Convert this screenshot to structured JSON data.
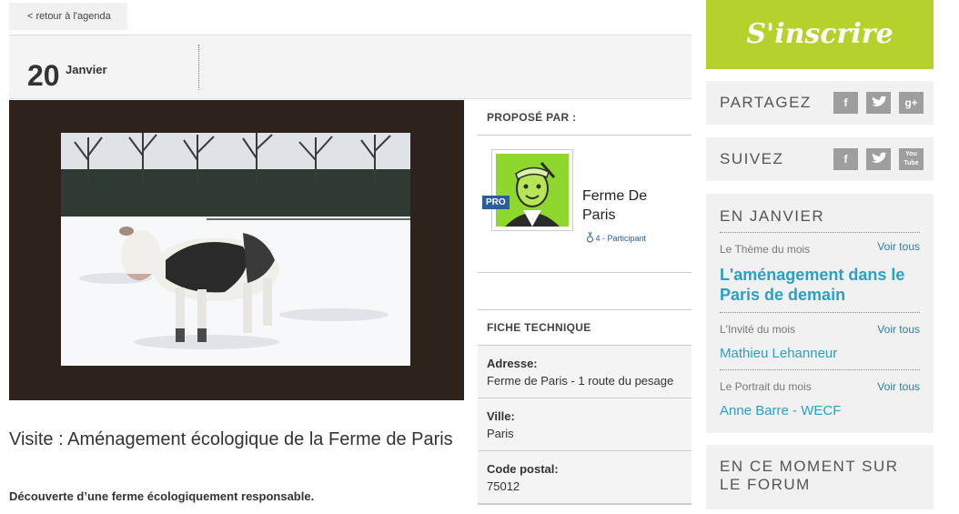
{
  "nav": {
    "back_label": "< retour à l'agenda"
  },
  "date": {
    "day": "20",
    "month": "Janvier"
  },
  "event": {
    "title": "Visite : Aménagement écologique de la Ferme de Paris",
    "subtitle": "Découverte d’une ferme écologiquement responsable."
  },
  "organizer": {
    "heading": "PROPOSÉ PAR :",
    "badge": "PRO",
    "name": "Ferme De Paris",
    "rank": "4 -  Participant"
  },
  "fiche": {
    "heading": "FICHE TECHNIQUE",
    "rows": [
      {
        "label": "Adresse:",
        "value": "Ferme de Paris - 1 route du pesage"
      },
      {
        "label": "Ville:",
        "value": "Paris"
      },
      {
        "label": "Code postal:",
        "value": "75012"
      }
    ]
  },
  "sidebar": {
    "signup_label": "S'inscrire",
    "share": {
      "label": "PARTAGEZ",
      "buttons": [
        "f",
        "t",
        "g+"
      ]
    },
    "follow": {
      "label": "SUIVEZ",
      "buttons": [
        "f",
        "t",
        "You Tube"
      ]
    },
    "january": {
      "title": "EN JANVIER",
      "items": [
        {
          "category": "Le Thème du mois",
          "see_all": "Voir tous",
          "value": "L'aménagement dans le Paris de demain"
        },
        {
          "category": "L'Invité du mois",
          "see_all": "Voir tous",
          "value": "Mathieu Lehanneur"
        },
        {
          "category": "Le Portrait du mois",
          "see_all": "Voir tous",
          "value": "Anne Barre - WECF"
        }
      ]
    },
    "forum_title": "EN CE MOMENT SUR LE FORUM"
  },
  "colors": {
    "accent_green": "#b4d12c",
    "link_blue": "#2aa0c8",
    "photo_frame": "#2e221d",
    "pro_badge": "#2a5d9f"
  },
  "icons": [
    "facebook-icon",
    "twitter-icon",
    "google-plus-icon",
    "youtube-icon",
    "rank-medal-icon"
  ]
}
